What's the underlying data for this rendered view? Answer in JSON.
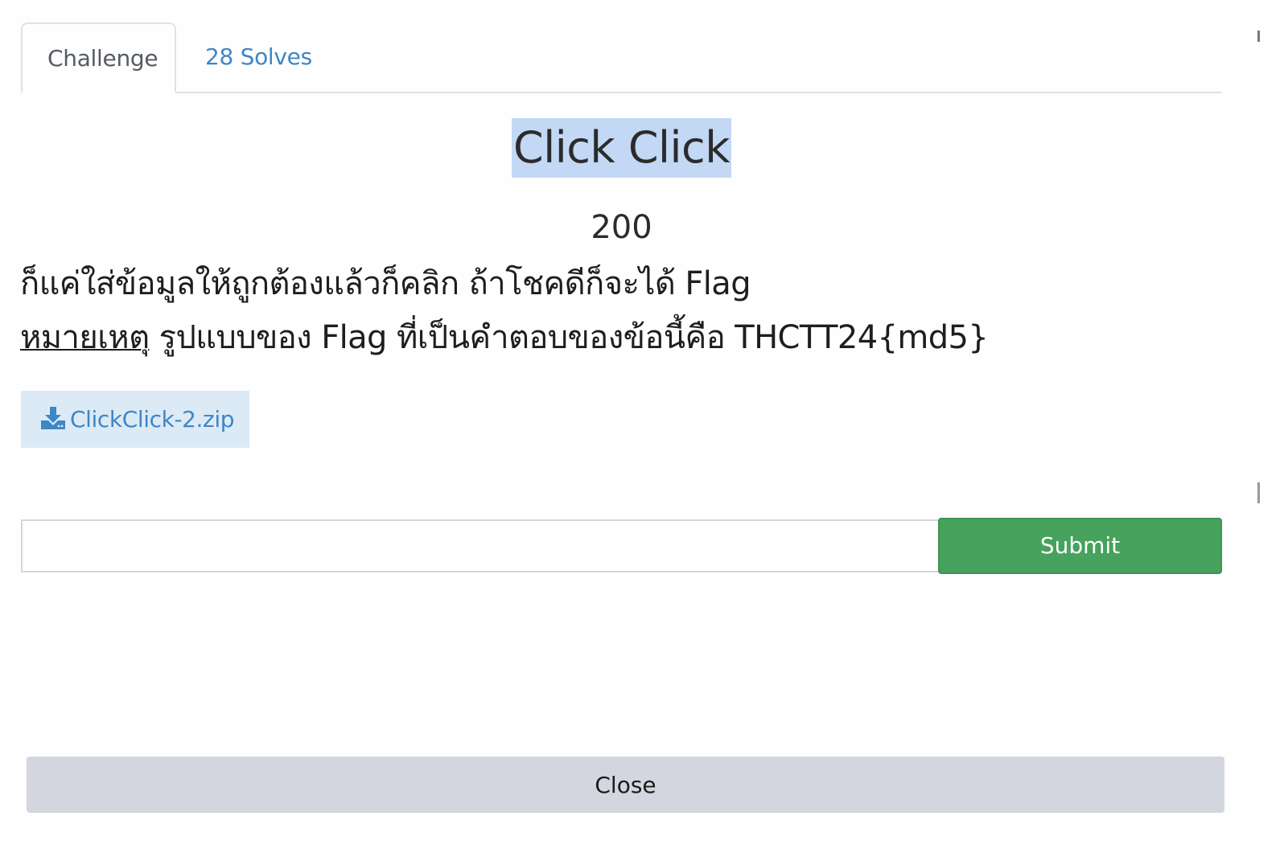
{
  "tabs": {
    "challenge": "Challenge",
    "solves": "28 Solves"
  },
  "challenge": {
    "title": "Click Click",
    "value": "200",
    "description_line1": "ก็แค่ใส่ข้อมูลให้ถูกต้องแล้วก็คลิก ถ้าโชคดีก็จะได้ Flag",
    "note_label": "หมายเหตุ",
    "description_line2": " รูปแบบของ Flag ที่เป็นคำตอบของข้อนี้คือ THCTT24{md5}"
  },
  "file": {
    "name": "ClickClick-2.zip",
    "icon": "download-icon"
  },
  "submission": {
    "input_value": "",
    "input_placeholder": "",
    "submit_label": "Submit"
  },
  "footer": {
    "close_label": "Close"
  },
  "colors": {
    "link": "#3f86c4",
    "submit": "#46a25c",
    "title_highlight": "#c2d8f5",
    "close_bg": "#d3d6de"
  }
}
